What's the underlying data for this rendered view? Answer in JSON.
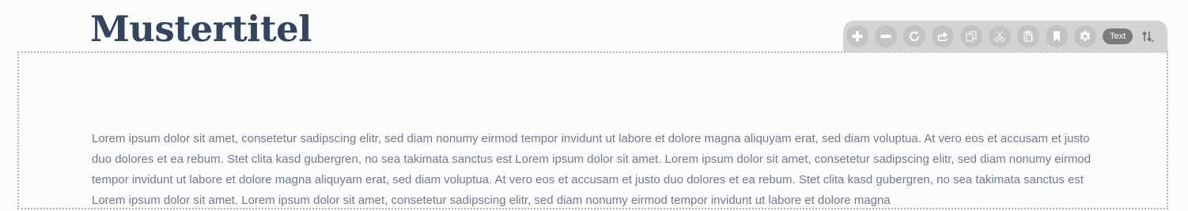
{
  "page": {
    "title": "Mustertitel",
    "body_text": "Lorem ipsum dolor sit amet, consetetur sadipscing elitr, sed diam nonumy eirmod tempor invidunt ut labore et dolore magna aliquyam erat, sed diam voluptua. At vero eos et accusam et justo duo dolores et ea rebum. Stet clita kasd gubergren, no sea takimata sanctus est Lorem ipsum dolor sit amet. Lorem ipsum dolor sit amet, consetetur sadipscing elitr, sed diam nonumy eirmod tempor invidunt ut labore et dolore magna aliquyam erat, sed diam voluptua. At vero eos et accusam et justo duo dolores et ea rebum. Stet clita kasd gubergren, no sea takimata sanctus est Lorem ipsum dolor sit amet. Lorem ipsum dolor sit amet, consetetur sadipscing elitr, sed diam nonumy eirmod tempor invidunt ut labore et dolore magna"
  },
  "toolbar": {
    "buttons": [
      {
        "icon": "plus-icon",
        "state": "active"
      },
      {
        "icon": "minus-icon",
        "state": "active"
      },
      {
        "icon": "refresh-icon",
        "state": "active"
      },
      {
        "icon": "share-icon",
        "state": "active"
      },
      {
        "icon": "copy-icon",
        "state": "dim"
      },
      {
        "icon": "cut-icon",
        "state": "dim"
      },
      {
        "icon": "paste-icon",
        "state": "dim"
      },
      {
        "icon": "bookmark-icon",
        "state": "active"
      },
      {
        "icon": "gear-icon",
        "state": "active"
      }
    ],
    "type_label": "Text",
    "sort_icon": "sort-icon"
  },
  "colors": {
    "title": "#34435e",
    "body_text": "#707a8d",
    "toolbar_bg": "#d3d3d3",
    "button_bg": "#c3c3c3",
    "label_bg": "#7b7b7b",
    "border": "#b3b3b3"
  }
}
